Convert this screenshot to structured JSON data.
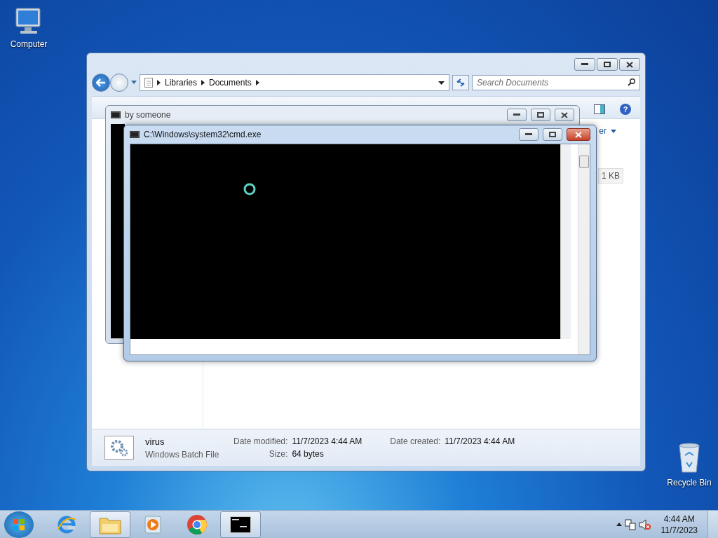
{
  "desktop_icons": [
    {
      "kind": "computer",
      "label": "Computer"
    },
    {
      "kind": "recycle-bin",
      "label": "Recycle Bin"
    }
  ],
  "explorer": {
    "breadcrumb": [
      "Libraries",
      "Documents"
    ],
    "search": {
      "placeholder": "Search Documents"
    },
    "help_glyph": "?",
    "toolbar_partial": "er",
    "size_partial": "1 KB",
    "details": {
      "name": "virus",
      "type": "Windows Batch File",
      "fields": [
        {
          "label": "Date modified:",
          "value": "11/7/2023 4:44 AM"
        },
        {
          "label": "Date created:",
          "value": "11/7/2023 4:44 AM"
        },
        {
          "label": "Size:",
          "value": "64 bytes"
        }
      ]
    }
  },
  "background_console": {
    "title": "by someone"
  },
  "console": {
    "title": "C:\\Windows\\system32\\cmd.exe"
  },
  "taskbar": {
    "items": [
      {
        "kind": "browser-e",
        "running": false
      },
      {
        "kind": "folder",
        "running": true
      },
      {
        "kind": "media",
        "running": false
      },
      {
        "kind": "chrome",
        "running": false
      },
      {
        "kind": "console",
        "running": true
      }
    ],
    "clock": {
      "time": "4:44 AM",
      "date": "11/7/2023"
    }
  }
}
